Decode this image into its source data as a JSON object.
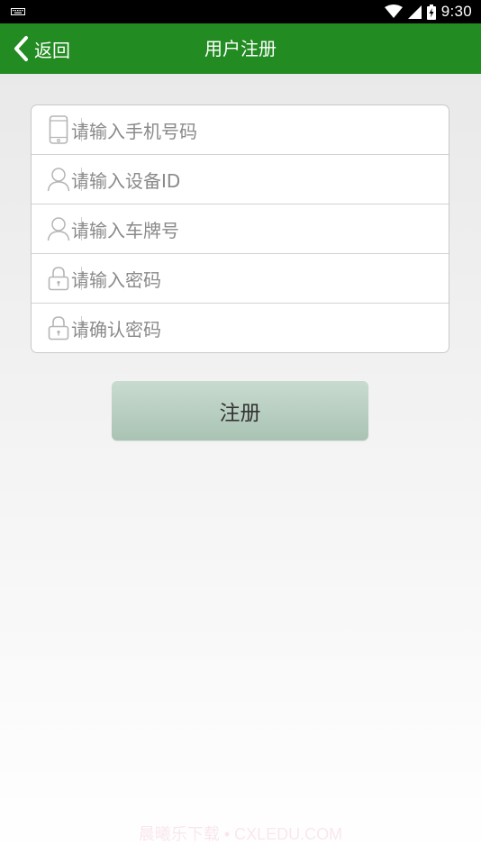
{
  "status_bar": {
    "time": "9:30",
    "icons": [
      "keyboard-icon",
      "wifi-icon",
      "signal-icon",
      "battery-charging-icon"
    ]
  },
  "app_bar": {
    "back_label": "返回",
    "title": "用户注册",
    "background_color": "#228b22"
  },
  "form": {
    "fields": [
      {
        "icon": "phone-icon",
        "placeholder": "请输入手机号码"
      },
      {
        "icon": "user-icon",
        "placeholder": "请输入设备ID"
      },
      {
        "icon": "user-icon",
        "placeholder": "请输入车牌号"
      },
      {
        "icon": "lock-icon",
        "placeholder": "请输入密码"
      },
      {
        "icon": "lock-icon",
        "placeholder": "请确认密码"
      }
    ]
  },
  "register_button": {
    "label": "注册"
  },
  "watermark": {
    "text": "晨曦乐下载 • CXLEDU.COM"
  }
}
